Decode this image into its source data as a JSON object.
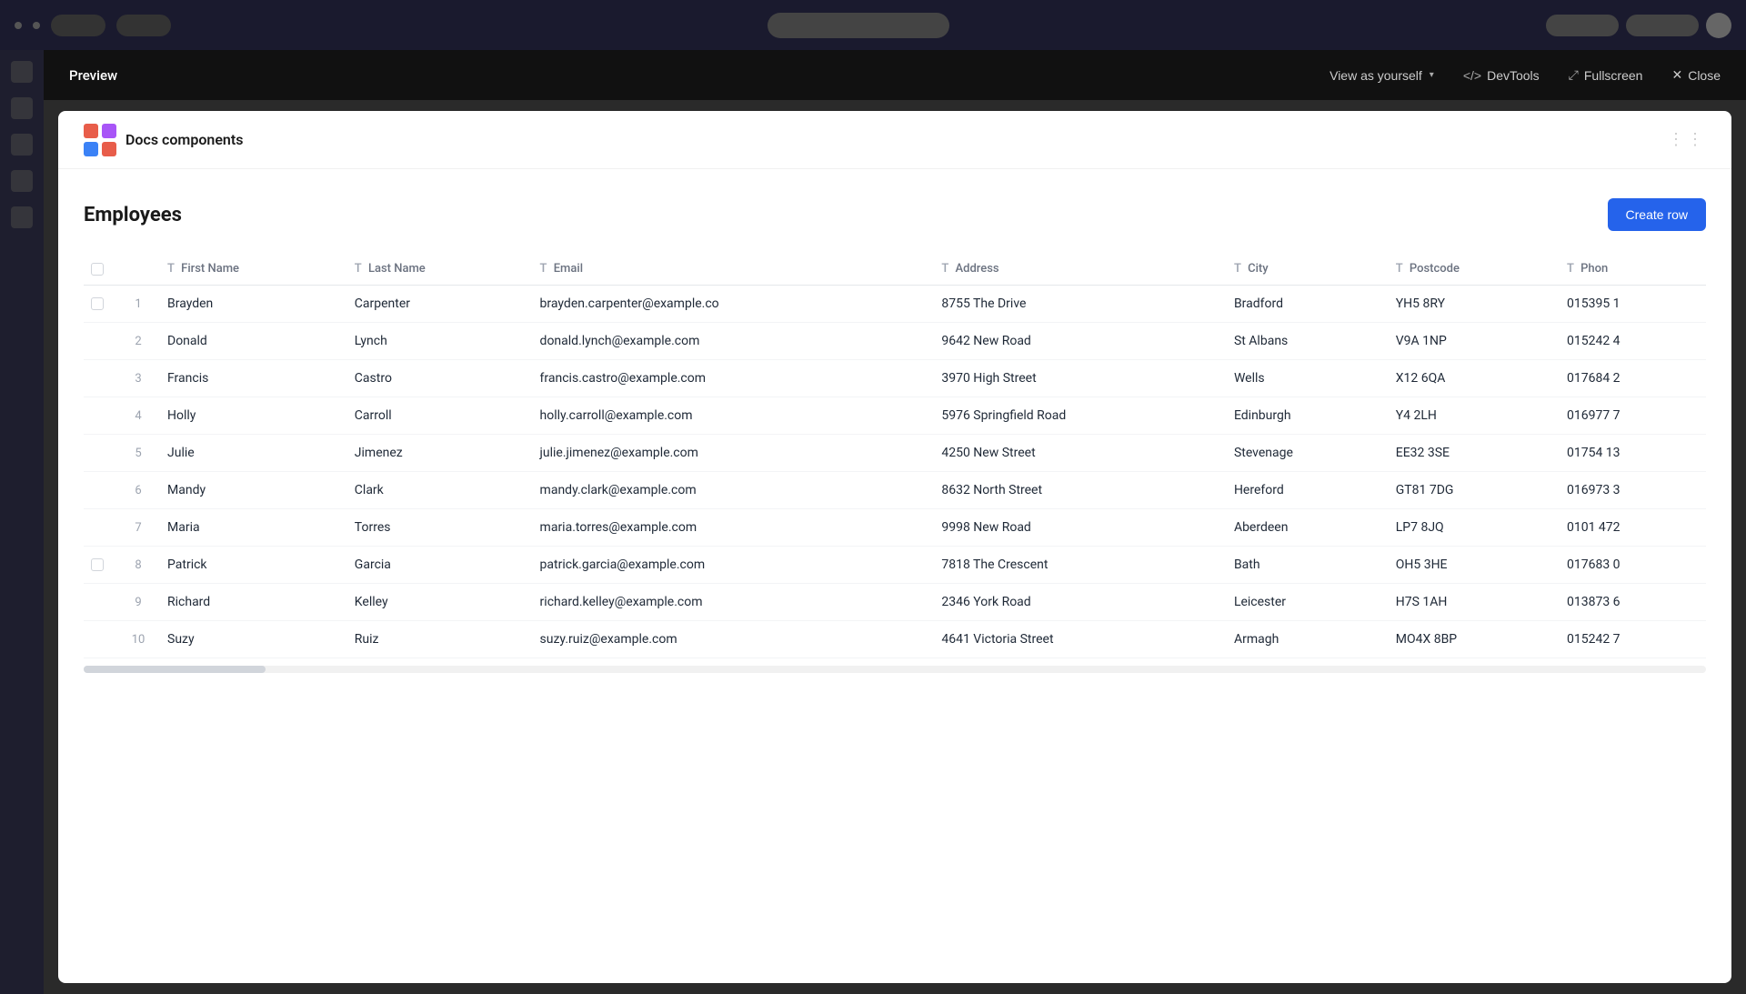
{
  "appBar": {
    "centerLabel": "Docs components"
  },
  "previewHeader": {
    "title": "Preview",
    "viewAsLabel": "View as yourself",
    "devToolsLabel": "DevTools",
    "fullscreenLabel": "Fullscreen",
    "closeLabel": "Close"
  },
  "appHeader": {
    "appName": "Docs components"
  },
  "section": {
    "title": "Employees",
    "createRowLabel": "Create row"
  },
  "table": {
    "columns": [
      {
        "icon": "T",
        "label": "First Name"
      },
      {
        "icon": "T",
        "label": "Last Name"
      },
      {
        "icon": "T",
        "label": "Email"
      },
      {
        "icon": "T",
        "label": "Address"
      },
      {
        "icon": "T",
        "label": "City"
      },
      {
        "icon": "T",
        "label": "Postcode"
      },
      {
        "icon": "T",
        "label": "Phon"
      }
    ],
    "rows": [
      {
        "num": "1",
        "firstName": "Brayden",
        "lastName": "Carpenter",
        "email": "brayden.carpenter@example.co",
        "address": "8755 The Drive",
        "city": "Bradford",
        "postcode": "YH5 8RY",
        "phone": "015395 1"
      },
      {
        "num": "2",
        "firstName": "Donald",
        "lastName": "Lynch",
        "email": "donald.lynch@example.com",
        "address": "9642 New Road",
        "city": "St Albans",
        "postcode": "V9A 1NP",
        "phone": "015242 4"
      },
      {
        "num": "3",
        "firstName": "Francis",
        "lastName": "Castro",
        "email": "francis.castro@example.com",
        "address": "3970 High Street",
        "city": "Wells",
        "postcode": "X12 6QA",
        "phone": "017684 2"
      },
      {
        "num": "4",
        "firstName": "Holly",
        "lastName": "Carroll",
        "email": "holly.carroll@example.com",
        "address": "5976 Springfield Road",
        "city": "Edinburgh",
        "postcode": "Y4 2LH",
        "phone": "016977 7"
      },
      {
        "num": "5",
        "firstName": "Julie",
        "lastName": "Jimenez",
        "email": "julie.jimenez@example.com",
        "address": "4250 New Street",
        "city": "Stevenage",
        "postcode": "EE32 3SE",
        "phone": "01754 13"
      },
      {
        "num": "6",
        "firstName": "Mandy",
        "lastName": "Clark",
        "email": "mandy.clark@example.com",
        "address": "8632 North Street",
        "city": "Hereford",
        "postcode": "GT81 7DG",
        "phone": "016973 3"
      },
      {
        "num": "7",
        "firstName": "Maria",
        "lastName": "Torres",
        "email": "maria.torres@example.com",
        "address": "9998 New Road",
        "city": "Aberdeen",
        "postcode": "LP7 8JQ",
        "phone": "0101 472"
      },
      {
        "num": "8",
        "firstName": "Patrick",
        "lastName": "Garcia",
        "email": "patrick.garcia@example.com",
        "address": "7818 The Crescent",
        "city": "Bath",
        "postcode": "OH5 3HE",
        "phone": "017683 0"
      },
      {
        "num": "9",
        "firstName": "Richard",
        "lastName": "Kelley",
        "email": "richard.kelley@example.com",
        "address": "2346 York Road",
        "city": "Leicester",
        "postcode": "H7S 1AH",
        "phone": "013873 6"
      },
      {
        "num": "10",
        "firstName": "Suzy",
        "lastName": "Ruiz",
        "email": "suzy.ruiz@example.com",
        "address": "4641 Victoria Street",
        "city": "Armagh",
        "postcode": "MO4X 8BP",
        "phone": "015242 7"
      }
    ]
  }
}
